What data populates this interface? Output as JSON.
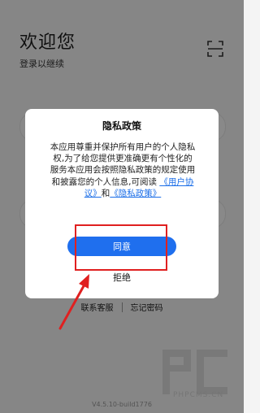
{
  "header": {
    "title": "欢迎您",
    "subtitle": "登录以继续",
    "scan_icon": "scan-frame-icon"
  },
  "dialog": {
    "title": "隐私政策",
    "body_text": "本应用尊重并保护所有用户的个人隐私权,为了给您提供更准确更有个性化的服务本应用会按照隐私政策的规定使用和披露您的个人信息,可阅读",
    "user_agreement_link": "《用户协议》",
    "and_text": "和",
    "privacy_policy_link": "《隐私政策》",
    "agree_label": "同意",
    "reject_label": "拒绝"
  },
  "footer": {
    "contact_service": "联系客服",
    "forgot_password": "忘记密码",
    "version": "V4.5.10-build1776"
  },
  "watermark": {
    "text": "PHPCMS.CN"
  },
  "colors": {
    "accent": "#1f6fee",
    "link": "#1b6ee8",
    "annotation": "#e02020"
  }
}
